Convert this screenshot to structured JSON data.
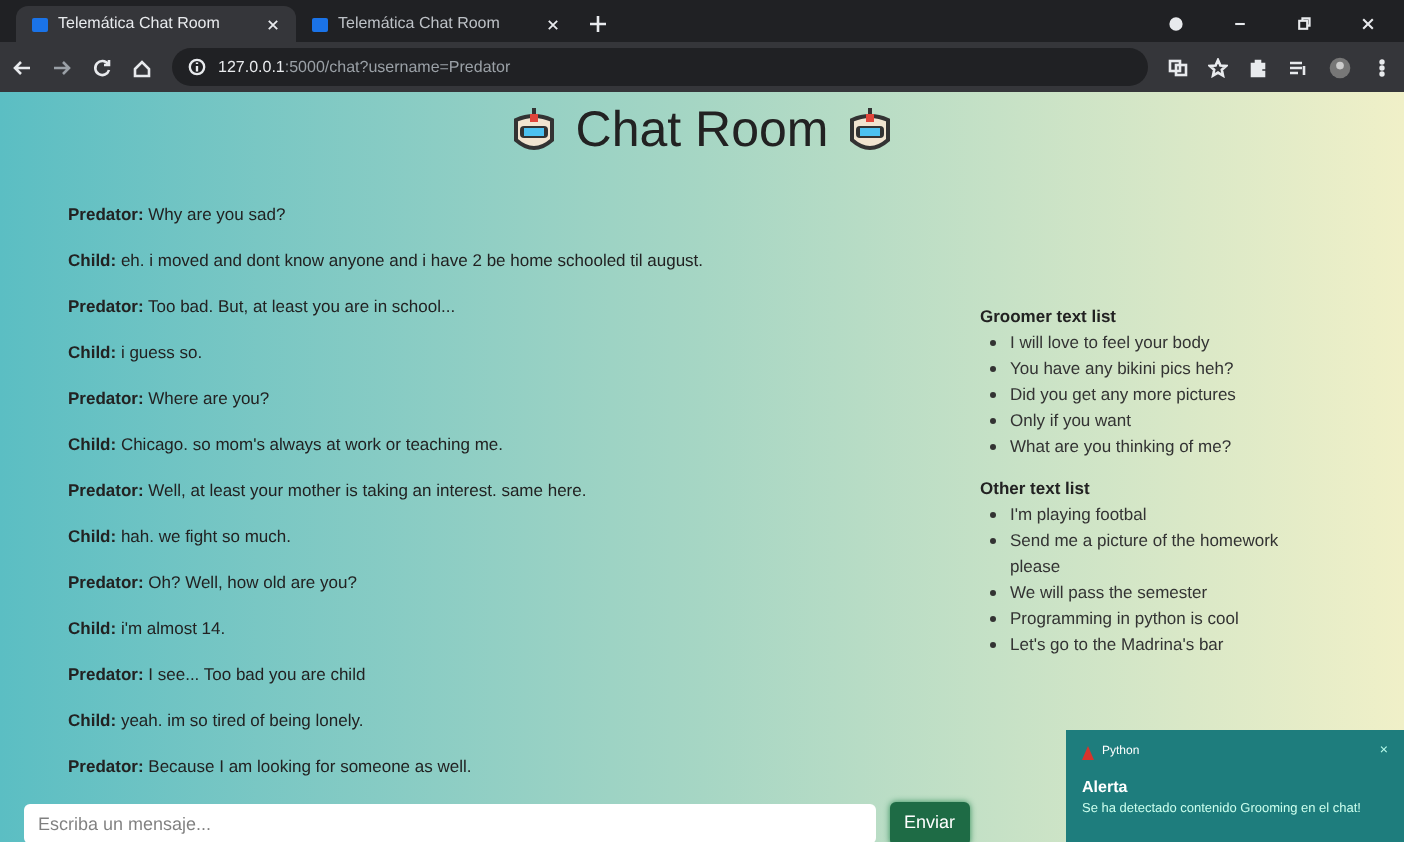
{
  "browser": {
    "tabs": [
      {
        "title": "Telemática Chat Room",
        "selected": true
      },
      {
        "title": "Telemática Chat Room",
        "selected": false
      }
    ],
    "url_host": "127.0.0.1",
    "url_rest": ":5000/chat?username=Predator"
  },
  "page": {
    "title": "Chat Room",
    "messages": [
      {
        "speaker": "Predator:",
        "text": "Why are you sad?"
      },
      {
        "speaker": "Child:",
        "text": "eh. i moved and dont know anyone and i have 2 be home schooled til august."
      },
      {
        "speaker": "Predator:",
        "text": "Too bad. But, at least you are in school..."
      },
      {
        "speaker": "Child:",
        "text": "i guess so."
      },
      {
        "speaker": "Predator:",
        "text": "Where are you?"
      },
      {
        "speaker": "Child:",
        "text": "Chicago. so mom's always at work or teaching me."
      },
      {
        "speaker": "Predator:",
        "text": "Well, at least your mother is taking an interest. same here."
      },
      {
        "speaker": "Child:",
        "text": "hah. we fight so much."
      },
      {
        "speaker": "Predator:",
        "text": "Oh? Well, how old are you?"
      },
      {
        "speaker": "Child:",
        "text": "i'm almost 14."
      },
      {
        "speaker": "Predator:",
        "text": "I see... Too bad you are child"
      },
      {
        "speaker": "Child:",
        "text": "yeah. im so tired of being lonely."
      },
      {
        "speaker": "Predator:",
        "text": "Because I am looking for someone as well."
      }
    ],
    "lists": [
      {
        "heading": "Groomer text list",
        "items": [
          "I will love to feel your body",
          "You have any bikini pics heh?",
          "Did you get any more pictures",
          "Only if you want",
          "What are you thinking of me?"
        ]
      },
      {
        "heading": "Other text list",
        "items": [
          "I'm playing footbal",
          "Send me a picture of the homework please",
          "We will pass the semester",
          "Programming in python is cool",
          "Let's go to the Madrina's bar"
        ]
      }
    ],
    "input": {
      "placeholder": "Escriba un mensaje..."
    },
    "send_button": "Enviar"
  },
  "notification": {
    "app": "Python",
    "close": "×",
    "title": "Alerta",
    "message": "Se ha detectado contenido Grooming en el chat!"
  }
}
